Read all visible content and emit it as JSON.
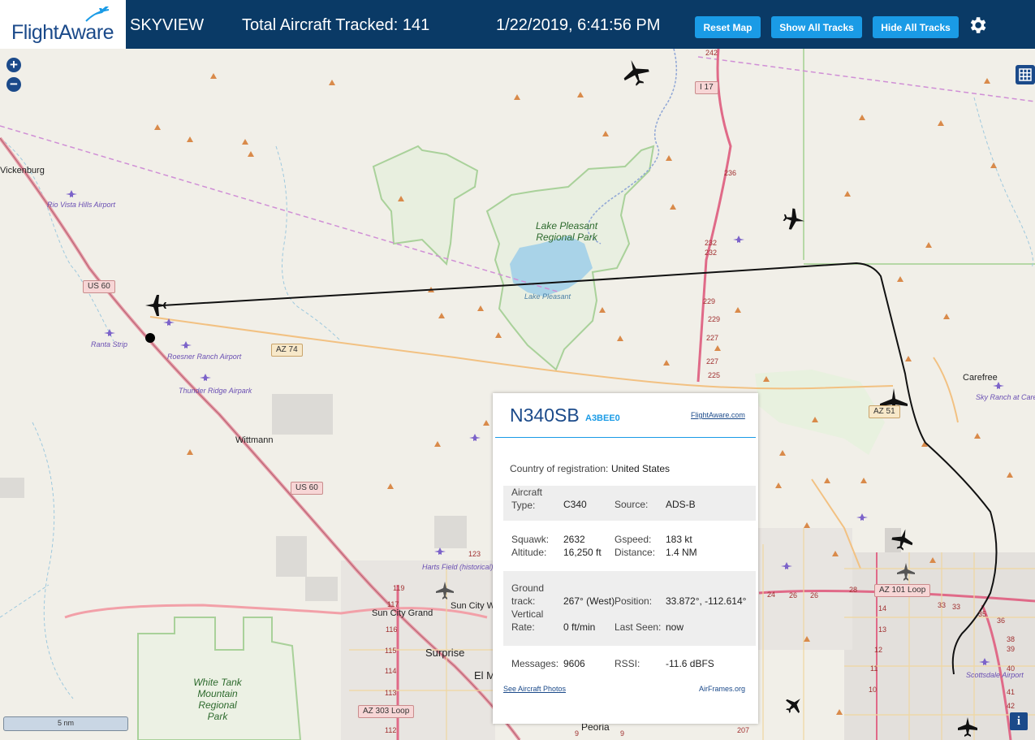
{
  "header": {
    "logo": "FlightAware",
    "app_title": "SKYVIEW",
    "tracked": "Total Aircraft Tracked: 141",
    "datetime": "1/22/2019, 6:41:56 PM",
    "reset_label": "Reset Map",
    "show_label": "Show All Tracks",
    "hide_label": "Hide All Tracks"
  },
  "map": {
    "zoom_in": "+",
    "zoom_out": "−",
    "scale": "5 nm",
    "info": "i",
    "places": [
      "Vickenburg",
      "Wittmann",
      "Surprise",
      "Sun City Grand",
      "Sun City W",
      "El M",
      "Peoria",
      "Carefree"
    ],
    "airports": [
      "Rio Vista Hills Airport",
      "Ranta Strip",
      "Roesner Ranch Airport",
      "Thunder Ridge Airpark",
      "Harts Field (historical)",
      "Sky Ranch at Carefree",
      "Scottsdale Airport"
    ],
    "parks": [
      "Lake Pleasant Regional Park",
      "White Tank Mountain Regional Park"
    ],
    "water": "Lake Pleasant",
    "roads": [
      "US 60",
      "AZ 74",
      "I 17",
      "US 60",
      "AZ 303 Loop",
      "AZ 101 Loop",
      "AZ 51"
    ],
    "route_numbers": [
      "242",
      "236",
      "232",
      "232",
      "229",
      "229",
      "227",
      "227",
      "225",
      "123",
      "119",
      "117",
      "116",
      "115",
      "114",
      "113",
      "112",
      "24",
      "26",
      "26",
      "28",
      "14",
      "13",
      "12",
      "11",
      "10",
      "33",
      "33",
      "35",
      "36",
      "38",
      "39",
      "40",
      "41",
      "42",
      "207",
      "9",
      "9"
    ]
  },
  "popup": {
    "callsign": "N340SB",
    "hex": "A3BEE0",
    "link": "FlightAware.com",
    "country_label": "Country of registration:",
    "country_value": "United States",
    "type_label": "Aircraft Type:",
    "type_value": "C340",
    "source_label": "Source:",
    "source_value": "ADS-B",
    "squawk_label": "Squawk:",
    "squawk_value": "2632",
    "altitude_label": "Altitude:",
    "altitude_value": "16,250 ft",
    "gspeed_label": "Gspeed:",
    "gspeed_value": "183 kt",
    "distance_label": "Distance:",
    "distance_value": "1.4 NM",
    "track_label": "Ground track:",
    "track_value": "267° (West)",
    "position_label": "Position:",
    "position_value": "33.872°, -112.614°",
    "vrate_label": "Vertical Rate:",
    "vrate_value": "0 ft/min",
    "lastseen_label": "Last Seen:",
    "lastseen_value": "now",
    "messages_label": "Messages:",
    "messages_value": "9606",
    "rssi_label": "RSSI:",
    "rssi_value": "-11.6 dBFS",
    "photos_link": "See Aircraft Photos",
    "airframes_link": "AirFrames.org"
  },
  "colors": {
    "header_bg": "#0a3a66",
    "button_bg": "#1a9be6",
    "map_bg": "#f1efe8",
    "track": "#111111",
    "highway": "#e0708a"
  }
}
